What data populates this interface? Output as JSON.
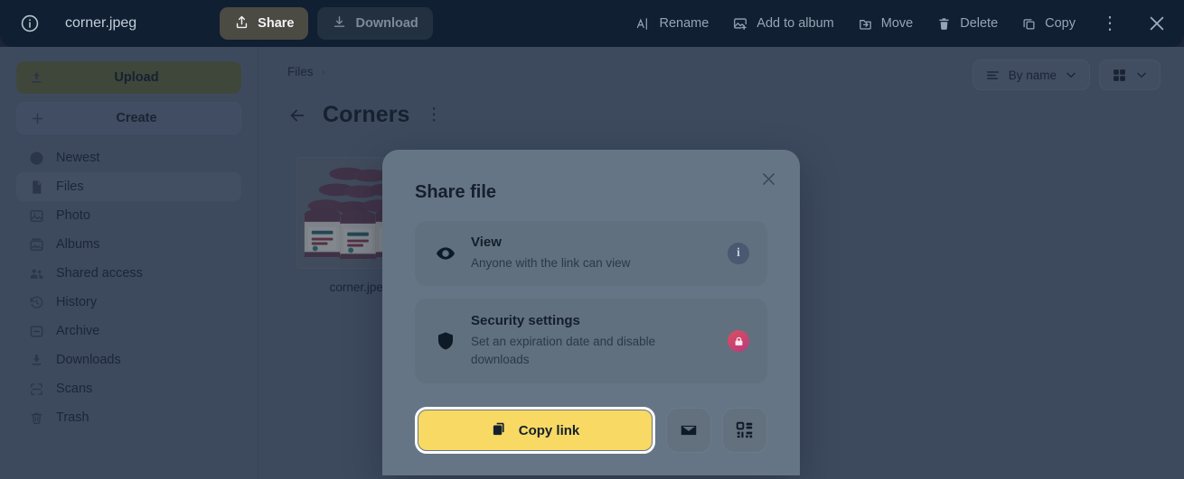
{
  "topbar": {
    "info_icon": "info-circle-icon",
    "filename": "corner.jpeg",
    "share_label": "Share",
    "share_icon": "share-upload-icon",
    "download_label": "Download",
    "download_icon": "download-icon",
    "actions": [
      {
        "label": "Rename",
        "icon": "rename-text-cursor-icon"
      },
      {
        "label": "Add to album",
        "icon": "add-to-album-icon"
      },
      {
        "label": "Move",
        "icon": "move-folder-icon"
      },
      {
        "label": "Delete",
        "icon": "trash-icon"
      },
      {
        "label": "Copy",
        "icon": "copy-icon"
      }
    ],
    "kebab_icon": "more-vertical-icon",
    "kebab_glyph": "⋮",
    "close_icon": "close-x-icon"
  },
  "sidebar": {
    "upload_label": "Upload",
    "upload_icon": "upload-arrow-icon",
    "create_label": "Create",
    "create_icon": "plus-icon",
    "items": [
      {
        "label": "Newest",
        "icon": "clock-icon",
        "active": false
      },
      {
        "label": "Files",
        "icon": "file-icon",
        "active": true
      },
      {
        "label": "Photo",
        "icon": "photo-icon",
        "active": false
      },
      {
        "label": "Albums",
        "icon": "albums-icon",
        "active": false
      },
      {
        "label": "Shared access",
        "icon": "shared-users-icon",
        "active": false
      },
      {
        "label": "History",
        "icon": "history-icon",
        "active": false
      },
      {
        "label": "Archive",
        "icon": "archive-icon",
        "active": false
      },
      {
        "label": "Downloads",
        "icon": "download-icon",
        "active": false
      },
      {
        "label": "Scans",
        "icon": "scan-icon",
        "active": false
      },
      {
        "label": "Trash",
        "icon": "trash-icon",
        "active": false
      }
    ]
  },
  "content": {
    "breadcrumb_root": "Files",
    "breadcrumb_separator": "›",
    "back_icon": "arrow-left-icon",
    "folder_title": "Corners",
    "folder_kebab_icon": "more-vertical-icon",
    "folder_kebab_glyph": "⋮",
    "sort_label": "By name",
    "sort_icon": "sort-lines-icon",
    "sort_chevron_icon": "chevron-down-icon",
    "layout_icon": "grid-view-icon",
    "layout_chevron_icon": "chevron-down-icon",
    "files": [
      {
        "name": "corner.jpeg",
        "thumbnail": "jars-of-jam-photo"
      }
    ]
  },
  "modal": {
    "title": "Share file",
    "close_icon": "close-x-icon",
    "options": [
      {
        "title": "View",
        "subtitle": "Anyone with the link can view",
        "icon": "eye-icon",
        "badge": "info-badge",
        "badge_glyph": "i"
      },
      {
        "title": "Security settings",
        "subtitle": "Set an expiration date and disable downloads",
        "icon": "shield-icon",
        "badge": "lock-badge"
      }
    ],
    "copy_label": "Copy link",
    "copy_icon": "copy-icon",
    "email_icon": "envelope-icon",
    "qr_icon": "qr-code-icon"
  },
  "colors": {
    "topbar_bg": "#101f31",
    "page_bg": "#56647a",
    "modal_bg": "#667585",
    "accent_yellow": "#f7d964",
    "upload_olive": "#5a6044",
    "lock_badge_from": "#d9505f",
    "lock_badge_to": "#b93a7e",
    "focus_ring": "#ffffff"
  }
}
